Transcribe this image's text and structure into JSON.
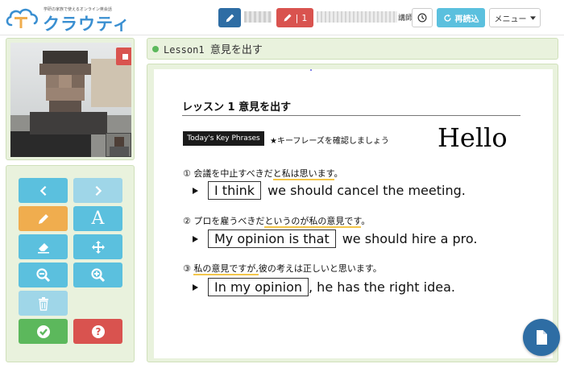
{
  "header": {
    "logo_tagline": "学研の家族で使えるオンライン英会話",
    "logo_name": "クラウティ",
    "pen_count_label": "1",
    "lecturer_suffix": "講師",
    "reload_label": "再読込",
    "menu_label": "メニュー"
  },
  "lesson": {
    "prefix": "Lesson1",
    "title": "意見を出す"
  },
  "document": {
    "heading": "レッスン 1 意見を出す",
    "key_badge": "Today's Key Phrases",
    "key_note": "★キーフレーズを確認しましょう",
    "hello": "Hello",
    "items": [
      {
        "number": "①",
        "q_pre": "会議を中止すべきだ",
        "q_hl": "と私は思います",
        "q_post": "。",
        "boxed": "I think",
        "rest": "we should cancel the meeting."
      },
      {
        "number": "②",
        "q_pre": "プロを雇うべきだ",
        "q_hl": "というのが私の意見です",
        "q_post": "。",
        "boxed": "My opinion is that",
        "rest": "we should hire a pro."
      },
      {
        "number": "③",
        "q_pre": "",
        "q_hl": "私の意見ですが,",
        "q_post": "彼の考えは正しいと思います。",
        "boxed": "In my opinion",
        "rest": ", he has the right idea."
      }
    ]
  },
  "colors": {
    "primary": "#2e6da4",
    "danger": "#d9534f",
    "info": "#5bc0de",
    "warning": "#f0ad4e",
    "success": "#5cb85c",
    "panel": "#e9f2dd",
    "logo": "#3a8fd1",
    "highlight": "#f3c64a"
  },
  "icons": {
    "pen": "pencil-icon",
    "clock": "clock-icon",
    "reload": "refresh-icon",
    "menu": "caret-down-icon",
    "stop": "stop-icon",
    "prev": "chevron-left-icon",
    "next": "chevron-right-icon",
    "text": "text-A-icon",
    "eraser": "eraser-icon",
    "move": "move-arrows-icon",
    "zoom_out": "zoom-out-icon",
    "zoom_in": "zoom-in-icon",
    "trash": "trash-icon",
    "check": "check-circle-icon",
    "help": "question-circle-icon",
    "file": "file-icon"
  }
}
